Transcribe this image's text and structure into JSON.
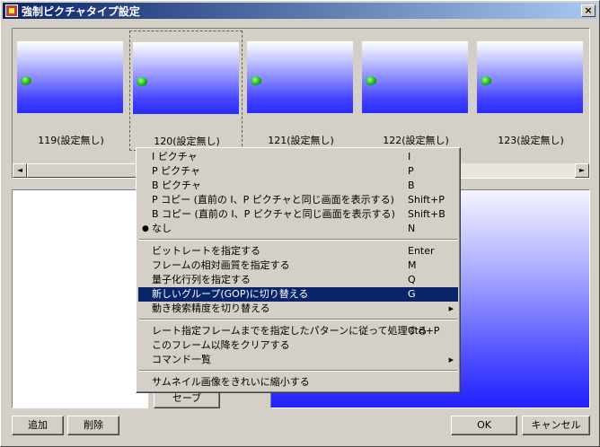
{
  "window": {
    "title": "強制ピクチャタイプ設定",
    "close": "×"
  },
  "thumbnails": [
    {
      "label": "119(設定無し)"
    },
    {
      "label": "120(設定無し)"
    },
    {
      "label": "121(設定無し)"
    },
    {
      "label": "122(設定無し)"
    },
    {
      "label": "123(設定無し)"
    }
  ],
  "scrollbar": {
    "left": "◄",
    "right": "►"
  },
  "context_menu": {
    "group1": [
      {
        "label": "I ピクチャ",
        "shortcut": "I"
      },
      {
        "label": "P ピクチャ",
        "shortcut": "P"
      },
      {
        "label": "B ピクチャ",
        "shortcut": "B"
      },
      {
        "label": "P コピー (直前の I、P ピクチャと同じ画面を表示する)",
        "shortcut": "Shift+P"
      },
      {
        "label": "B コピー (直前の I、P ピクチャと同じ画面を表示する)",
        "shortcut": "Shift+B"
      },
      {
        "label": "なし",
        "shortcut": "N",
        "bullet": "●"
      }
    ],
    "group2": [
      {
        "label": "ビットレートを指定する",
        "shortcut": "Enter"
      },
      {
        "label": "フレームの相対画質を指定する",
        "shortcut": "M"
      },
      {
        "label": "量子化行列を指定する",
        "shortcut": "Q"
      },
      {
        "label": "新しいグループ(GOP)に切り替える",
        "shortcut": "G"
      },
      {
        "label": "動き検索精度を切り替える",
        "shortcut": "",
        "arrow": "▶"
      }
    ],
    "group3": [
      {
        "label": "レート指定フレームまでを指定したパターンに従って処理する",
        "shortcut": "Ctrl+P"
      },
      {
        "label": "このフレーム以降をクリアする",
        "shortcut": ""
      },
      {
        "label": "コマンド一覧",
        "shortcut": "",
        "arrow": "▶"
      }
    ],
    "group4": [
      {
        "label": "サムネイル画像をきれいに縮小する",
        "shortcut": ""
      }
    ]
  },
  "buttons": {
    "add": "追加",
    "delete": "削除",
    "save": "セーブ",
    "ok": "OK",
    "cancel": "キャンセル"
  }
}
